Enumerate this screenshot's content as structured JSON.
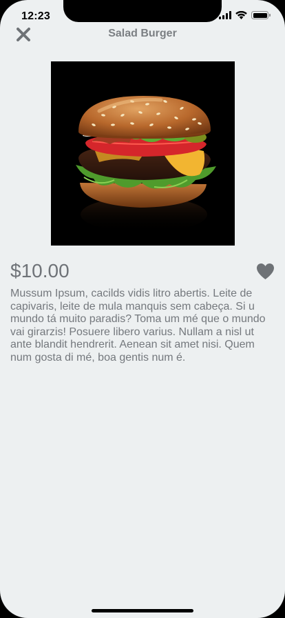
{
  "status_bar": {
    "time": "12:23",
    "signal_icon": "cellular-signal-icon",
    "wifi_icon": "wifi-icon",
    "battery_icon": "battery-icon"
  },
  "nav": {
    "close_icon": "close-icon",
    "title": "Salad Burger"
  },
  "product": {
    "image_icon": "burger-photo",
    "price": "$10.00",
    "favorite_icon": "heart-icon",
    "description": "Mussum Ipsum, cacilds vidis litro abertis. Leite de capivaris, leite de mula manquis sem cabeça. Si u mundo tá muito paradis? Toma um mé que o mundo vai girarzis! Posuere libero varius. Nullam a nisl ut ante blandit hendrerit. Aenean sit amet nisi. Quem num gosta di mé, boa gentis num é."
  },
  "colors": {
    "background": "#edf0f1",
    "text_muted": "#74787d",
    "icon_gray": "#6e7276"
  }
}
